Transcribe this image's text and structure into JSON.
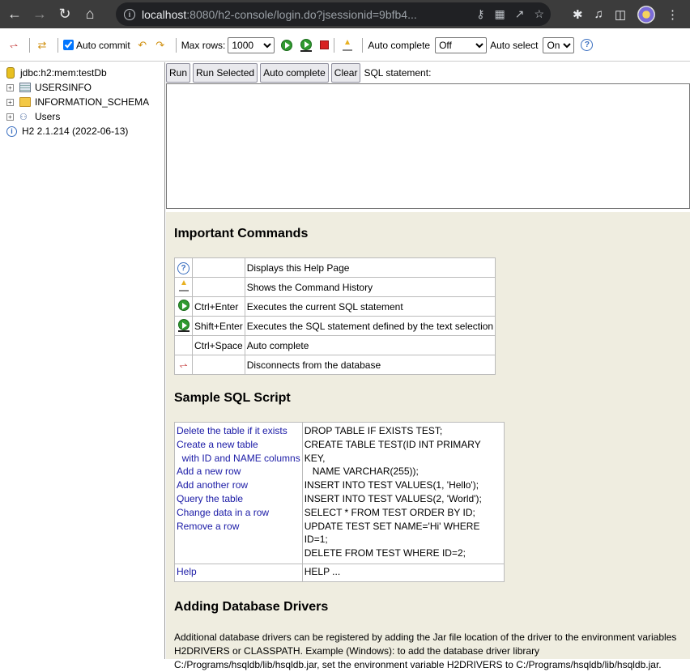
{
  "browser": {
    "url_host": "localhost",
    "url_path": ":8080/h2-console/login.do?jsessionid=9bfb4..."
  },
  "toolbar": {
    "auto_commit_label": "Auto commit",
    "auto_commit_checked": true,
    "max_rows_label": "Max rows:",
    "max_rows_value": "1000",
    "auto_complete_label": "Auto complete",
    "auto_complete_value": "Off",
    "auto_select_label": "Auto select",
    "auto_select_value": "On"
  },
  "tree": {
    "connection": "jdbc:h2:mem:testDb",
    "items": [
      {
        "label": "USERSINFO",
        "icon": "table-icon"
      },
      {
        "label": "INFORMATION_SCHEMA",
        "icon": "folder-icon"
      },
      {
        "label": "Users",
        "icon": "users-icon"
      }
    ],
    "version": "H2 2.1.214 (2022-06-13)"
  },
  "query": {
    "run": "Run",
    "run_selected": "Run Selected",
    "auto_complete": "Auto complete",
    "clear": "Clear",
    "sql_label": "SQL statement:",
    "sql_value": ""
  },
  "important": {
    "title": "Important Commands",
    "rows": [
      {
        "icon": "help-icon",
        "key": "",
        "desc": "Displays this Help Page"
      },
      {
        "icon": "history-icon",
        "key": "",
        "desc": "Shows the Command History"
      },
      {
        "icon": "run-icon",
        "key": "Ctrl+Enter",
        "desc": "Executes the current SQL statement"
      },
      {
        "icon": "run-selected-icon",
        "key": "Shift+Enter",
        "desc": "Executes the SQL statement defined by the text selection"
      },
      {
        "icon": "",
        "key": "Ctrl+Space",
        "desc": "Auto complete"
      },
      {
        "icon": "disconnect-icon",
        "key": "",
        "desc": "Disconnects from the database"
      }
    ]
  },
  "sample": {
    "title": "Sample SQL Script",
    "rows": [
      {
        "link": "Delete the table if it exists",
        "sql": "DROP TABLE IF EXISTS TEST;"
      },
      {
        "link": "Create a new table",
        "sql": "CREATE TABLE TEST(ID INT PRIMARY KEY,"
      },
      {
        "link": "  with ID and NAME columns",
        "sql": "   NAME VARCHAR(255));"
      },
      {
        "link": "Add a new row",
        "sql": "INSERT INTO TEST VALUES(1, 'Hello');"
      },
      {
        "link": "Add another row",
        "sql": "INSERT INTO TEST VALUES(2, 'World');"
      },
      {
        "link": "Query the table",
        "sql": "SELECT * FROM TEST ORDER BY ID;"
      },
      {
        "link": "Change data in a row",
        "sql": "UPDATE TEST SET NAME='Hi' WHERE ID=1;"
      },
      {
        "link": "Remove a row",
        "sql": "DELETE FROM TEST WHERE ID=2;"
      }
    ],
    "help_link": "Help",
    "help_sql": "HELP ..."
  },
  "drivers": {
    "title": "Adding Database Drivers",
    "text": "Additional database drivers can be registered by adding the Jar file location of the driver to the environment variables H2DRIVERS or CLASSPATH. Example (Windows): to add the database driver library C:/Programs/hsqldb/lib/hsqldb.jar, set the environment variable H2DRIVERS to C:/Programs/hsqldb/lib/hsqldb.jar."
  }
}
